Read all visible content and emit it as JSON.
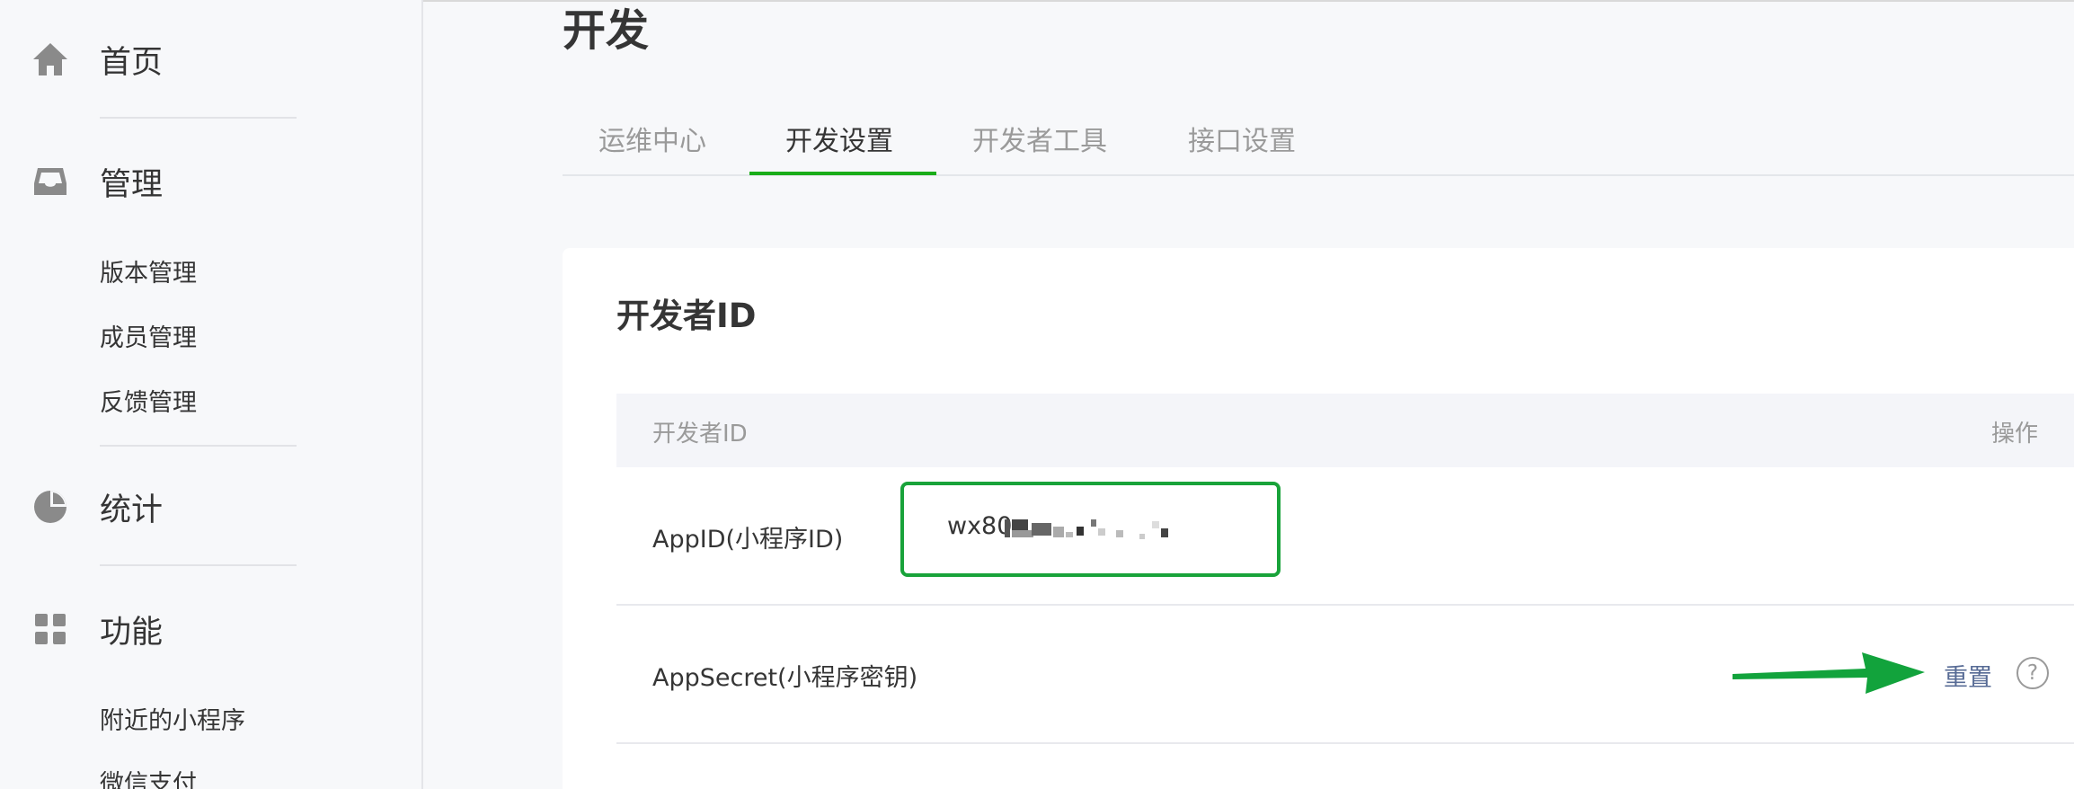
{
  "sidebar": {
    "items": [
      {
        "label": "首页",
        "icon": "home-icon"
      },
      {
        "label": "管理",
        "icon": "inbox-icon",
        "children": [
          "版本管理",
          "成员管理",
          "反馈管理"
        ]
      },
      {
        "label": "统计",
        "icon": "pie-chart-icon"
      },
      {
        "label": "功能",
        "icon": "grid-icon",
        "children": [
          "附近的小程序",
          "微信支付"
        ]
      }
    ]
  },
  "page": {
    "title": "开发"
  },
  "tabs": [
    "运维中心",
    "开发设置",
    "开发者工具",
    "接口设置"
  ],
  "active_tab": "开发设置",
  "card": {
    "title": "开发者ID",
    "table": {
      "headers": [
        "开发者ID",
        "操作"
      ],
      "rows": [
        {
          "label": "AppID(小程序ID)",
          "value": "wx80"
        },
        {
          "label": "AppSecret(小程序密钥)",
          "action": "重置",
          "help": "?"
        }
      ]
    }
  },
  "colors": {
    "accent_green": "#1aad19",
    "highlight_box": "#19a33a",
    "arrow_green": "#12a33c",
    "link": "#576b95"
  }
}
